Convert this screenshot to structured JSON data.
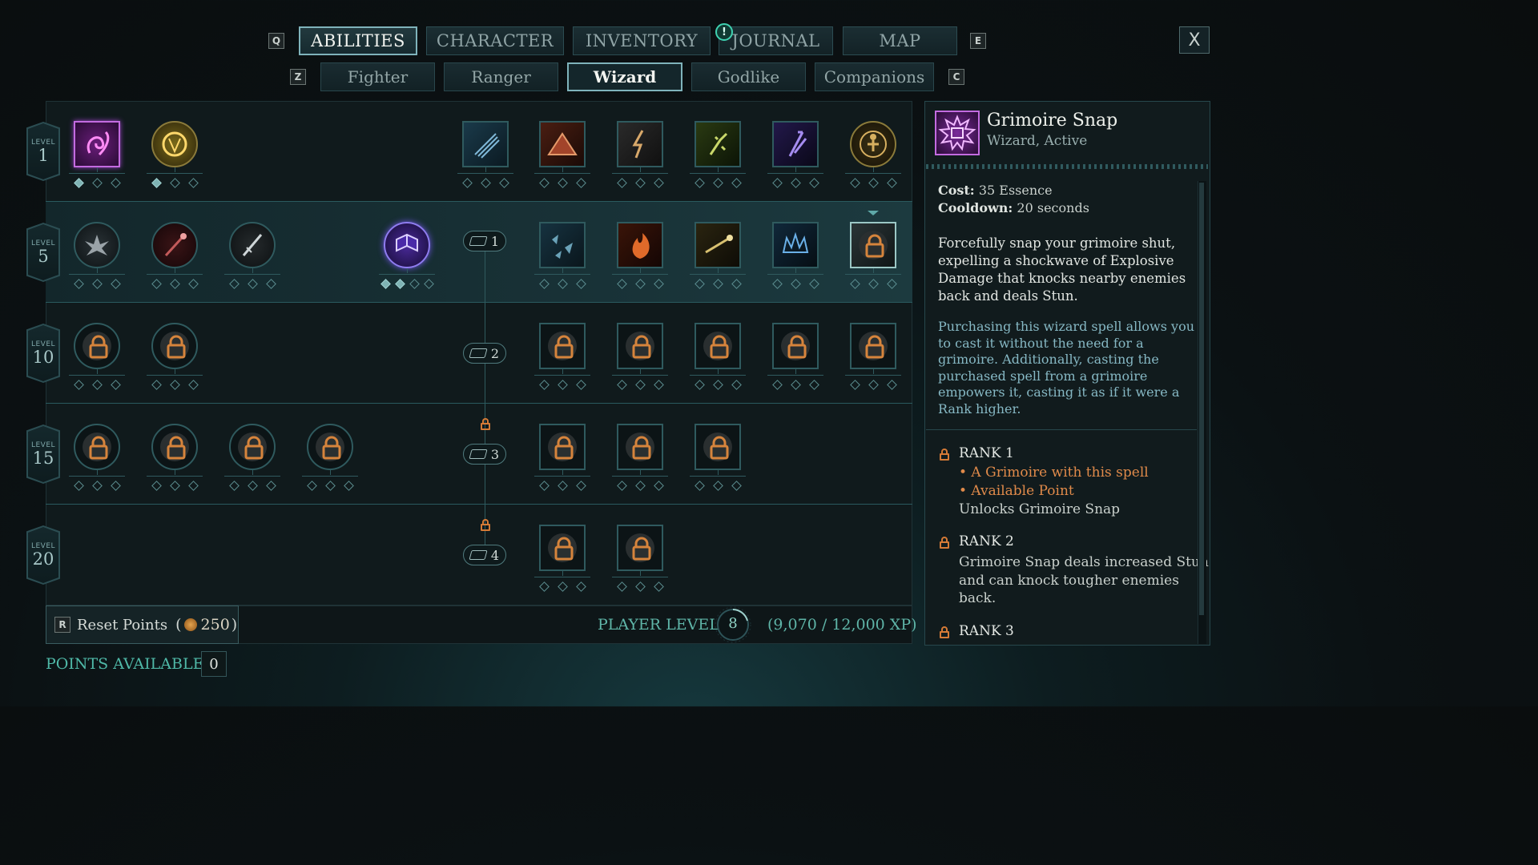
{
  "top_nav": {
    "key_prev": "Q",
    "key_next": "E",
    "tabs": [
      "ABILITIES",
      "CHARACTER",
      "INVENTORY",
      "JOURNAL",
      "MAP"
    ],
    "alert": "!",
    "close_label": "X"
  },
  "sub_nav": {
    "key_prev": "Z",
    "key_next": "C",
    "tabs": [
      "Fighter",
      "Ranger",
      "Wizard",
      "Godlike",
      "Companions"
    ]
  },
  "levels": [
    {
      "word": "LEVEL",
      "number": "1"
    },
    {
      "word": "LEVEL",
      "number": "5"
    },
    {
      "word": "LEVEL",
      "number": "10"
    },
    {
      "word": "LEVEL",
      "number": "15"
    },
    {
      "word": "LEVEL",
      "number": "20"
    }
  ],
  "grimoire_ranks": [
    "1",
    "2",
    "3",
    "4"
  ],
  "reset": {
    "key": "R",
    "label": "Reset Points",
    "open": "(",
    "cost": "250",
    "close": ")"
  },
  "player": {
    "label": "PLAYER LEVEL",
    "level": "8",
    "xp": "(9,070 / 12,000 XP)"
  },
  "points": {
    "label": "POINTS AVAILABLE",
    "value": "0"
  },
  "detail": {
    "title": "Grimoire Snap",
    "subtitle": "Wizard, Active",
    "cost_label": "Cost:",
    "cost_value": "35 Essence",
    "cooldown_label": "Cooldown:",
    "cooldown_value": "20 seconds",
    "desc_lines": [
      "Forcefully snap your grimoire shut,",
      "expelling a shockwave of Explosive",
      "Damage that knocks nearby enemies",
      "back and deals Stun."
    ],
    "note_lines": [
      "Purchasing this wizard spell allows you",
      "to cast it without the need for a",
      "grimoire. Additionally, casting the",
      "purchased spell from a grimoire",
      "empowers it, casting it as if it were a",
      "Rank higher."
    ],
    "rank1_title": "RANK 1",
    "rank1_req1": "• A Grimoire with this spell",
    "rank1_req2": "• Available Point",
    "rank1_text": "Unlocks Grimoire Snap",
    "rank2_title": "RANK 2",
    "rank2_lines": [
      "Grimoire Snap deals increased Stun",
      "and can knock tougher enemies",
      "back."
    ],
    "rank3_title": "RANK 3"
  },
  "colors": {
    "accent": "#7fb3bb",
    "lock": "#d47a36",
    "selected": "#c36be0",
    "gold": "#d4b04a"
  }
}
